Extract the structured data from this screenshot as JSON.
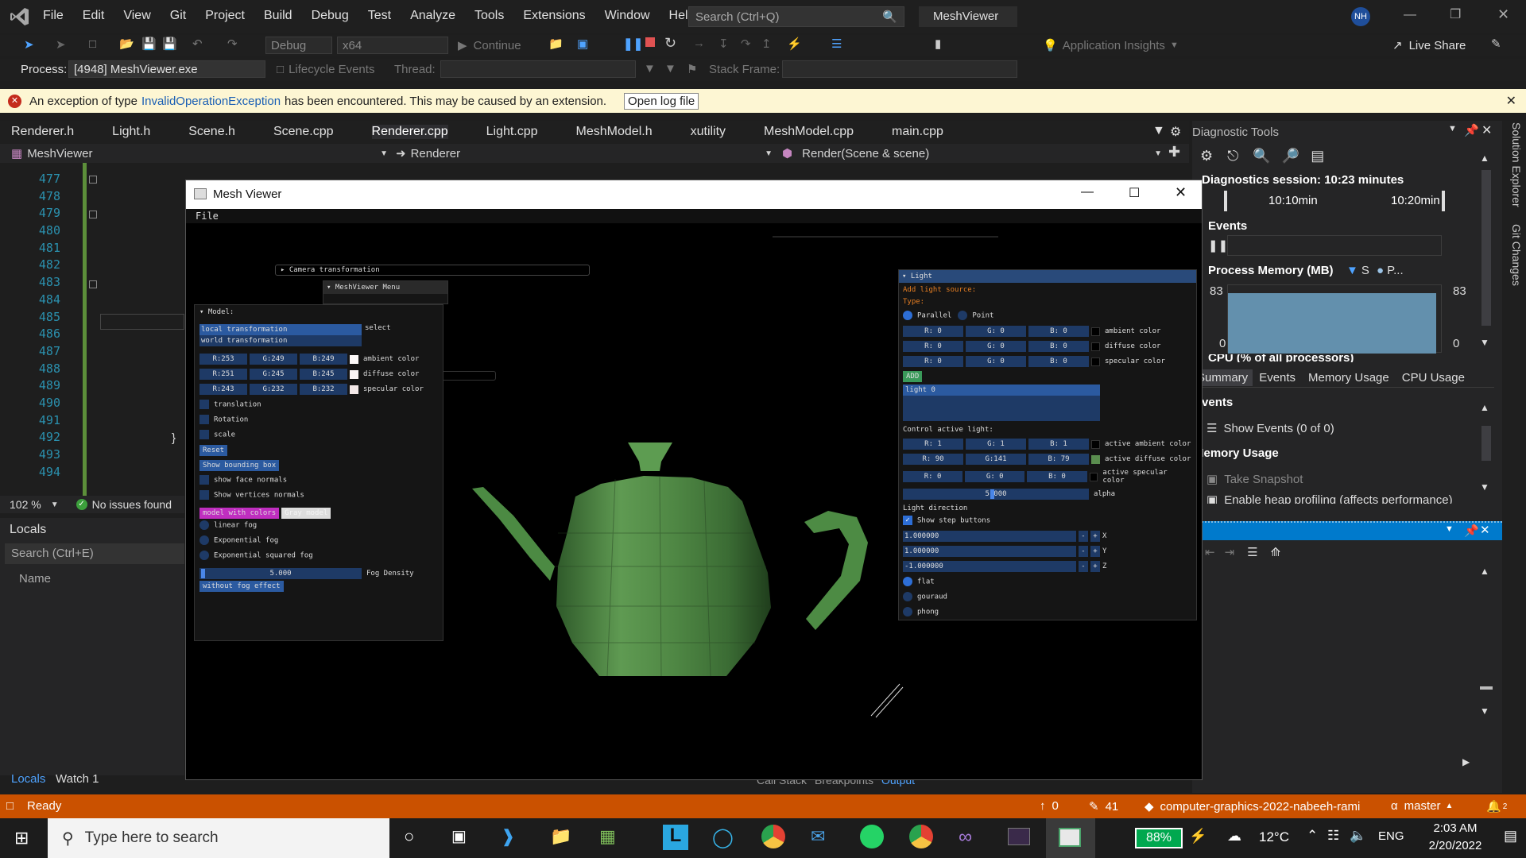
{
  "titlebar": {
    "menu": [
      "File",
      "Edit",
      "View",
      "Git",
      "Project",
      "Build",
      "Debug",
      "Test",
      "Analyze",
      "Tools",
      "Extensions",
      "Window",
      "Help"
    ],
    "search_placeholder": "Search (Ctrl+Q)",
    "solution_name": "MeshViewer",
    "user_initials": "NH"
  },
  "toolbar1": {
    "config": "Debug",
    "platform": "x64",
    "continue_label": "Continue",
    "app_insights": "Application Insights",
    "live_share": "Live Share"
  },
  "toolbar2": {
    "process_label": "Process:",
    "process_value": "[4948] MeshViewer.exe",
    "lifecycle": "Lifecycle Events",
    "thread_label": "Thread:",
    "stack_label": "Stack Frame:"
  },
  "infobar": {
    "prefix": "An exception of type",
    "exception": "InvalidOperationException",
    "suffix": "has been encountered. This may be caused by an extension.",
    "button": "Open log file"
  },
  "tabs": [
    "Renderer.h",
    "Light.h",
    "Scene.h",
    "Scene.cpp",
    "Renderer.cpp",
    "Light.cpp",
    "MeshModel.h",
    "xutility",
    "MeshModel.cpp",
    "main.cpp"
  ],
  "navbar": {
    "project": "MeshViewer",
    "scope": "Renderer",
    "member": "Render(Scene & scene)"
  },
  "editor": {
    "lines": [
      "477",
      "478",
      "479",
      "480",
      "481",
      "482",
      "483",
      "484",
      "485",
      "486",
      "487",
      "488",
      "489",
      "490",
      "491",
      "492",
      "493",
      "494"
    ],
    "zoom": "102 %",
    "issues": "No issues found"
  },
  "locals": {
    "title": "Locals",
    "search": "Search (Ctrl+E)",
    "col_name": "Name",
    "tab1": "Locals",
    "tab2": "Watch 1"
  },
  "bottom_tabs": [
    "Call Stack",
    "Breakpoints",
    "Output"
  ],
  "diag": {
    "title": "Diagnostic Tools",
    "session": "Diagnostics session: 10:23 minutes",
    "t1": "10:10min",
    "t2": "10:20min",
    "events": "Events",
    "memory_title": "Process Memory (MB)",
    "mem_legend_s": "S",
    "mem_legend_p": "P...",
    "mem_max": "83",
    "mem_min": "0",
    "cpu": "CPU (% of all processors)",
    "tabs": [
      "Summary",
      "Events",
      "Memory Usage",
      "CPU Usage"
    ],
    "sec_events": "Events",
    "show_events": "Show Events (0 of 0)",
    "sec_memory": "Memory Usage",
    "take_snapshot": "Take Snapshot",
    "heap": "Enable heap profiling (affects performance)"
  },
  "sidetabs": [
    "Solution Explorer",
    "Git Changes"
  ],
  "statusbar": {
    "ready": "Ready",
    "up": "0",
    "edits": "41",
    "repo": "computer-graphics-2022-nabeeh-rami",
    "branch": "master",
    "notif": "2"
  },
  "taskbar": {
    "search": "Type here to search",
    "battery": "88%",
    "temp": "12°C",
    "lang": "ENG",
    "time": "2:03 AM",
    "date": "2/20/2022"
  },
  "meshviewer": {
    "title": "Mesh Viewer",
    "menu": "File",
    "camera": "Camera transformation",
    "menu_panel": "MeshViewer Menu",
    "model": {
      "title": "Model:",
      "local": "local transformation",
      "world": "world transformation",
      "select": "select",
      "rows": [
        {
          "r": "R:253",
          "g": "G:249",
          "b": "B:249",
          "label": "ambient color",
          "color": "#fdf9f9"
        },
        {
          "r": "R:251",
          "g": "G:245",
          "b": "B:245",
          "label": "diffuse color",
          "color": "#fbf5f5"
        },
        {
          "r": "R:243",
          "g": "G:232",
          "b": "B:232",
          "label": "specular color",
          "color": "#f3e8e8"
        }
      ],
      "translation": "translation",
      "rotation": "Rotation",
      "scale": "scale",
      "reset": "Reset",
      "bbox": "Show bounding box",
      "face_normals": "show face normals",
      "vertex_normals": "Show vertices normals",
      "model_colors": "model with colors",
      "gray": "Gray model",
      "linear_fog": "linear fog",
      "exp_fog": "Exponential fog",
      "exp2_fog": "Exponential squared fog",
      "fog_density_value": "5.000",
      "fog_density": "Fog Density",
      "no_fog": "without fog effect"
    },
    "light": {
      "title": "Light",
      "add": "Add light source:",
      "type": "Type:",
      "parallel": "Parallel",
      "point": "Point",
      "rows": [
        {
          "r": "R: 0",
          "g": "G: 0",
          "b": "B: 0",
          "label": "ambient color"
        },
        {
          "r": "R: 0",
          "g": "G: 0",
          "b": "B: 0",
          "label": "diffuse color"
        },
        {
          "r": "R: 0",
          "g": "G: 0",
          "b": "B: 0",
          "label": "specular color"
        }
      ],
      "add_btn": "ADD",
      "list_item": "light 0",
      "control": "Control active light:",
      "active_rows": [
        {
          "r": "R: 1",
          "g": "G: 1",
          "b": "B: 1",
          "label": "active ambient color",
          "color": "#010101"
        },
        {
          "r": "R: 90",
          "g": "G:141",
          "b": "B: 79",
          "label": "active diffuse color",
          "color": "#5a8d4f"
        },
        {
          "r": "R: 0",
          "g": "G: 0",
          "b": "B: 0",
          "label": "active specular color",
          "color": "#000000"
        }
      ],
      "alpha_value": "5.000",
      "alpha": "alpha",
      "direction": "Light direction",
      "step": "Show step buttons",
      "dirs": [
        {
          "v": "1.000000",
          "axis": "X"
        },
        {
          "v": "1.000000",
          "axis": "Y"
        },
        {
          "v": "-1.000000",
          "axis": "Z"
        }
      ],
      "flat": "flat",
      "gouraud": "gouraud",
      "phong": "phong"
    }
  }
}
